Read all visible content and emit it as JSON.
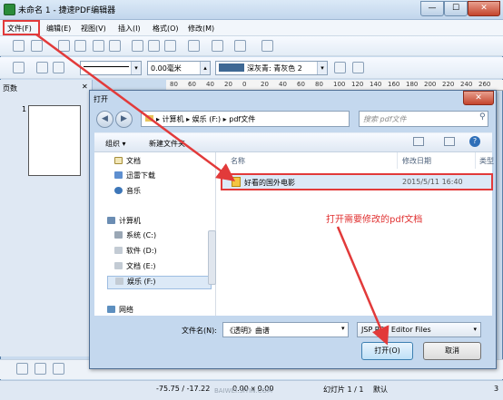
{
  "window": {
    "title": "未命名 1 - 捷速PDF编辑器",
    "min": "—",
    "max": "☐",
    "close": "✕"
  },
  "menu": {
    "items": [
      "文件(F)",
      "编辑(E)",
      "视图(V)",
      "插入(I)",
      "格式(O)",
      "修改(M)"
    ]
  },
  "toolbar2": {
    "line_width": "0.00毫米",
    "color_label": "深灰青: 青灰色 2"
  },
  "sidepane": {
    "title": "页数",
    "page_number": "1"
  },
  "ruler": {
    "ticks": [
      "80",
      "60",
      "40",
      "20",
      "0",
      "20",
      "40",
      "60",
      "80",
      "100",
      "120",
      "140",
      "160",
      "180",
      "200",
      "220",
      "240",
      "260"
    ]
  },
  "dialog": {
    "title": "打开",
    "close": "✕",
    "path": [
      "计算机",
      "娱乐 (F:)",
      "pdf文件"
    ],
    "search_placeholder": "搜索 pdf文件",
    "organize": "组织 ▾",
    "new_folder": "新建文件夹",
    "nav_items": [
      {
        "label": "文档",
        "icon": "document-icon"
      },
      {
        "label": "迅雷下载",
        "icon": "download-icon"
      },
      {
        "label": "音乐",
        "icon": "music-icon"
      },
      {
        "label": "计算机",
        "icon": "computer-icon"
      },
      {
        "label": "系统 (C:)",
        "icon": "drive-icon"
      },
      {
        "label": "软件 (D:)",
        "icon": "drive-icon"
      },
      {
        "label": "文档 (E:)",
        "icon": "drive-icon"
      },
      {
        "label": "娱乐 (F:)",
        "icon": "drive-icon"
      },
      {
        "label": "网络",
        "icon": "network-icon"
      }
    ],
    "columns": {
      "name": "名称",
      "modified": "修改日期",
      "type": "类型"
    },
    "files": [
      {
        "name": "好看的国外电影",
        "modified": "2015/5/11 16:40"
      }
    ],
    "filename_label": "文件名(N):",
    "filename_value": "《透明》曲谱",
    "filetype": "JSP PDF Editor Files",
    "open_button": "打开(O)",
    "cancel_button": "取消"
  },
  "annotation": "打开需要修改的pdf文档",
  "status": {
    "coords": "-75.75 / -17.22",
    "size": "0.00 x 0.00",
    "slide": "幻灯片 1 / 1",
    "mode": "默认",
    "page_total": "3"
  },
  "watermark": "BAIWEI.SIYIN.COM",
  "colors": {
    "highlight": "#e23a3a",
    "chrome": "#c9dbee",
    "selection": "#dce9f7"
  }
}
